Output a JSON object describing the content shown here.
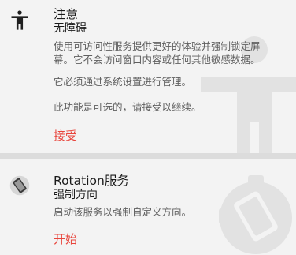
{
  "accessibility_card": {
    "title": "注意",
    "subtitle": "无障碍",
    "description_line1": "使用可访问性服务提供更好的体验并强制锁定屏",
    "description_line2": "幕。它不会访问窗口内容或任何其他敏感数据。",
    "manage_text": "它必须通过系统设置进行管理。",
    "optional_text": "此功能是可选的，请接受以继续。",
    "action_label": "接受",
    "icon": "accessibility-icon"
  },
  "rotation_card": {
    "title": "Rotation服务",
    "subtitle": "强制方向",
    "description": "启动该服务以强制自定义方向。",
    "action_label": "开始",
    "icon": "rotation-service-icon"
  },
  "colors": {
    "accent": "#e8453c",
    "card_background": "#f3f3f3",
    "page_background": "#dcdcdc"
  }
}
